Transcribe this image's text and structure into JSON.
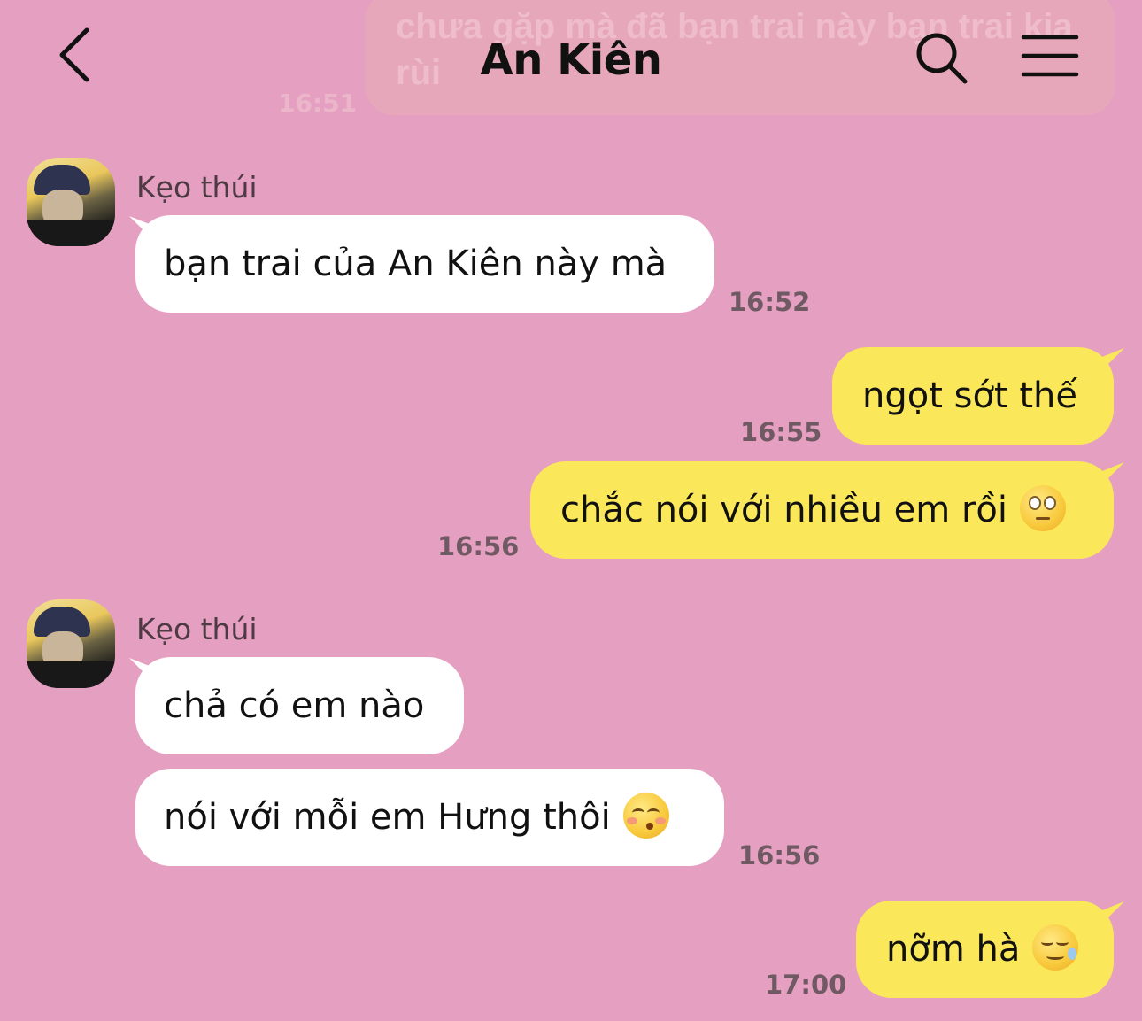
{
  "header": {
    "title": "An Kiên",
    "back_icon": "chevron-left-icon",
    "search_icon": "search-icon",
    "menu_icon": "hamburger-menu-icon"
  },
  "previous_message": {
    "text": "chưa gặp mà đã bạn trai này bạn trai kia rùi",
    "time": "16:51"
  },
  "messages": [
    {
      "sender": "Kẹo thúi",
      "direction": "incoming",
      "text": "bạn trai của An Kiên này mà",
      "time": "16:52"
    },
    {
      "direction": "outgoing",
      "text": "ngọt sớt thế",
      "time": "16:55"
    },
    {
      "direction": "outgoing",
      "text": "chắc nói với nhiều em rồi",
      "emoji": "face-with-rolling-eyes",
      "time": "16:56"
    },
    {
      "sender": "Kẹo thúi",
      "direction": "incoming",
      "text": "chả có em nào"
    },
    {
      "direction": "incoming",
      "text": "nói với mỗi em Hưng thôi",
      "emoji": "kissing-face-with-smiling-eyes",
      "time": "16:56"
    },
    {
      "direction": "outgoing",
      "text": "nỡm hà",
      "emoji": "sleeping-face",
      "time": "17:00"
    }
  ],
  "colors": {
    "background": "#e59fc1",
    "incoming_bubble": "#ffffff",
    "outgoing_bubble": "#fbe85a",
    "time_text": "#6f5962"
  }
}
